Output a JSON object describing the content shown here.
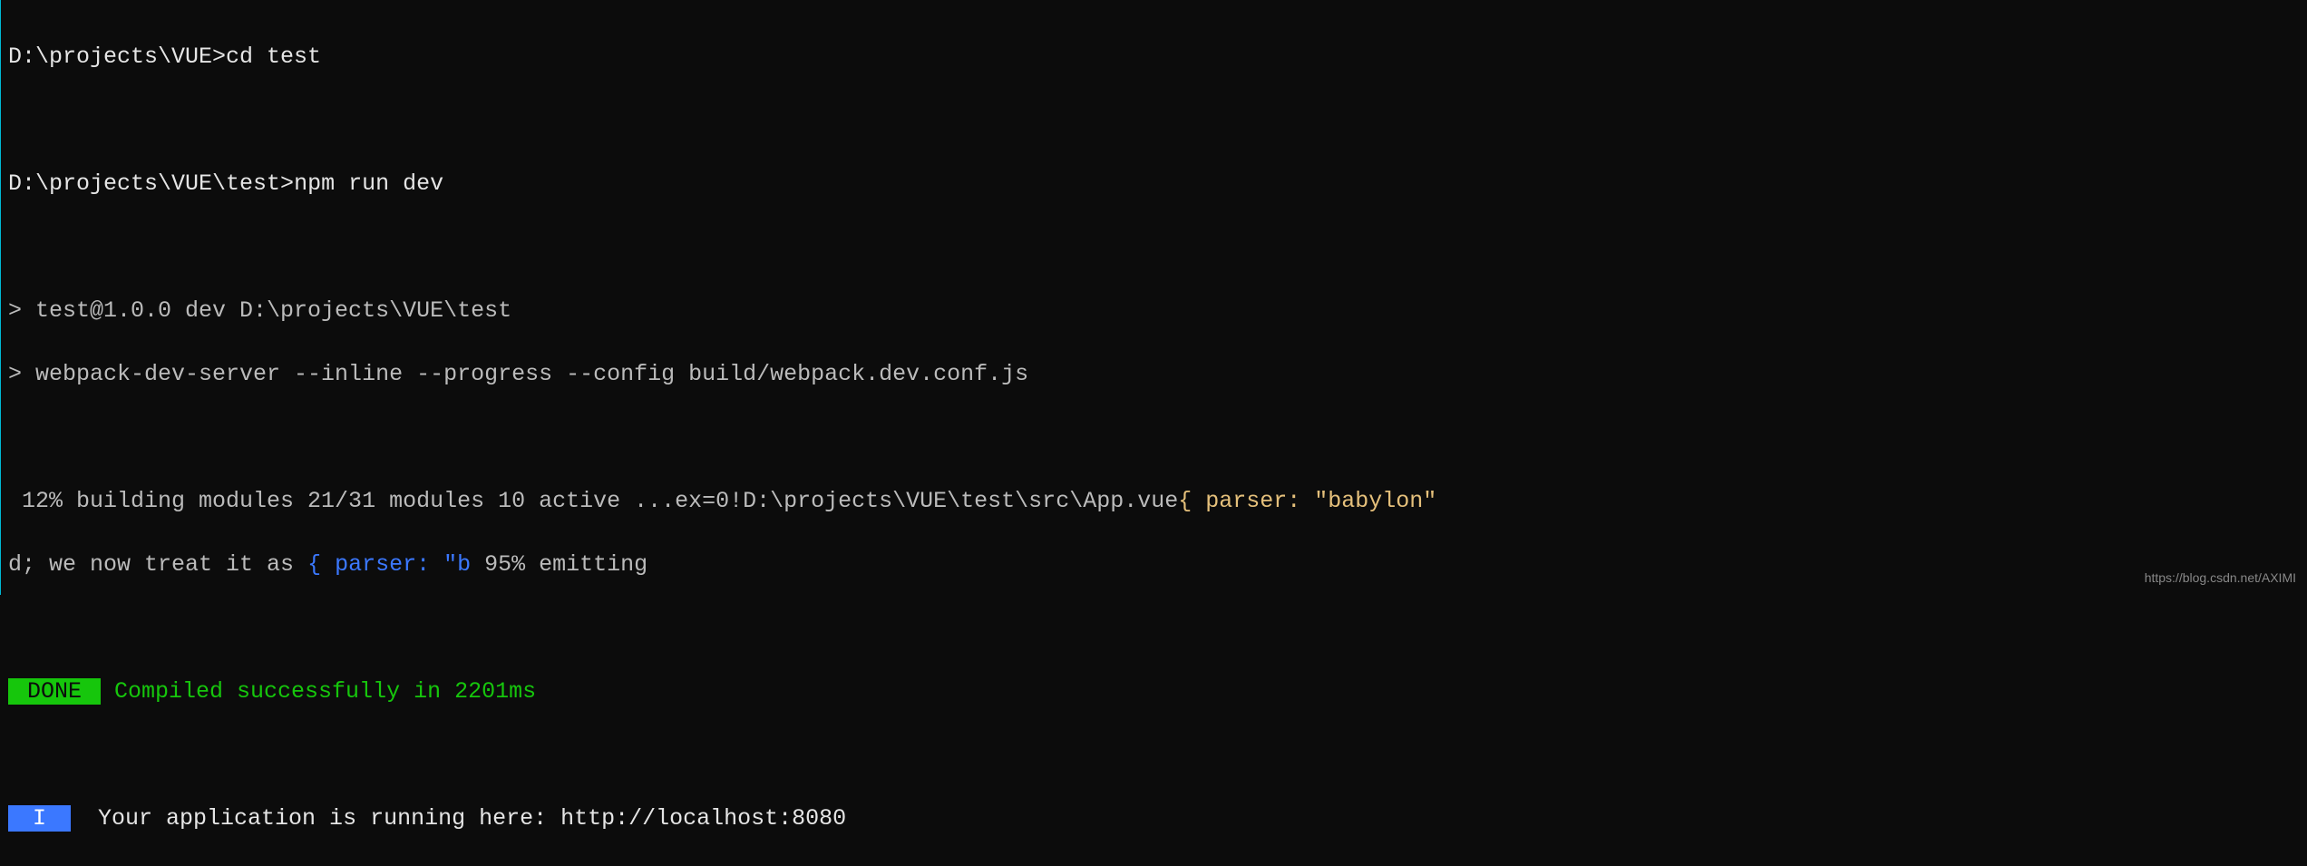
{
  "lines": {
    "prompt1": "D:\\projects\\VUE>",
    "cmd1": "cd test",
    "prompt2": "D:\\projects\\VUE\\test>",
    "cmd2": "npm run dev",
    "script1": "> test@1.0.0 dev D:\\projects\\VUE\\test",
    "script2": "> webpack-dev-server --inline --progress --config build/webpack.dev.conf.js",
    "building_a": " 12% building modules 21/31 modules 10 active ...ex=0!D:\\projects\\VUE\\test\\src\\App.vue",
    "building_b": "{ parser: \"babylon\"",
    "line2_a": "d; we now treat it as ",
    "line2_b": "{ parser: \"b",
    "line2_c": " 95% emitting",
    "done_label": " DONE ",
    "done_msg": " Compiled successfully in 2201ms",
    "i_label": " I ",
    "i_msg": "  Your application is running here: http://localhost:8080"
  },
  "watermark": "https://blog.csdn.net/AXIMI"
}
